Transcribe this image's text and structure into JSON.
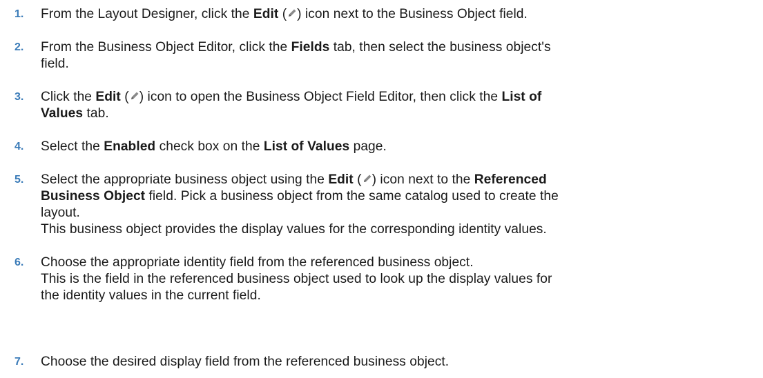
{
  "steps": [
    {
      "number": "1.",
      "lines": [
        {
          "pre": "From the Layout Designer, click the ",
          "b1": "Edit",
          "mid": " (",
          "post": ") icon next to the Business Object field."
        }
      ]
    },
    {
      "number": "2.",
      "lines": [
        {
          "pre": "From the Business Object Editor, click the ",
          "b1": "Fields",
          "post": " tab, then select the business object's"
        },
        {
          "text": "field."
        }
      ]
    },
    {
      "number": "3.",
      "lines": [
        {
          "pre": "Click the ",
          "b1": "Edit",
          "mid": " (",
          "post": ") icon to open the Business Object Field Editor, then click the ",
          "b2": "List of"
        },
        {
          "b1": "Values",
          "post": " tab."
        }
      ]
    },
    {
      "number": "4.",
      "lines": [
        {
          "pre": "Select the ",
          "b1": "Enabled",
          "mid": " check box on the ",
          "b2": "List of Values",
          "post": " page."
        }
      ]
    },
    {
      "number": "5.",
      "lines": [
        {
          "pre": "Select the appropriate business object using the ",
          "b1": "Edit",
          "mid": " (",
          "post": ") icon next to the ",
          "b2": "Referenced"
        },
        {
          "b1": "Business Object",
          "post": " field. Pick a business object from the same catalog used to create the"
        },
        {
          "text": "layout."
        },
        {
          "text": "This business object provides the display values for the corresponding identity values."
        }
      ]
    },
    {
      "number": "6.",
      "lines": [
        {
          "text": "Choose the appropriate identity field from the referenced business object."
        },
        {
          "text": "This is the field in the referenced business object used to look up the display values for"
        },
        {
          "text": "the identity values in the current field."
        }
      ]
    },
    {
      "number": "7.",
      "lines": [
        {
          "text": "Choose the desired display field from the referenced business object."
        }
      ]
    }
  ],
  "icons": {
    "edit": "pencil-icon"
  },
  "colors": {
    "step_number": "#3a7bb8",
    "text": "#1a1a1a"
  }
}
